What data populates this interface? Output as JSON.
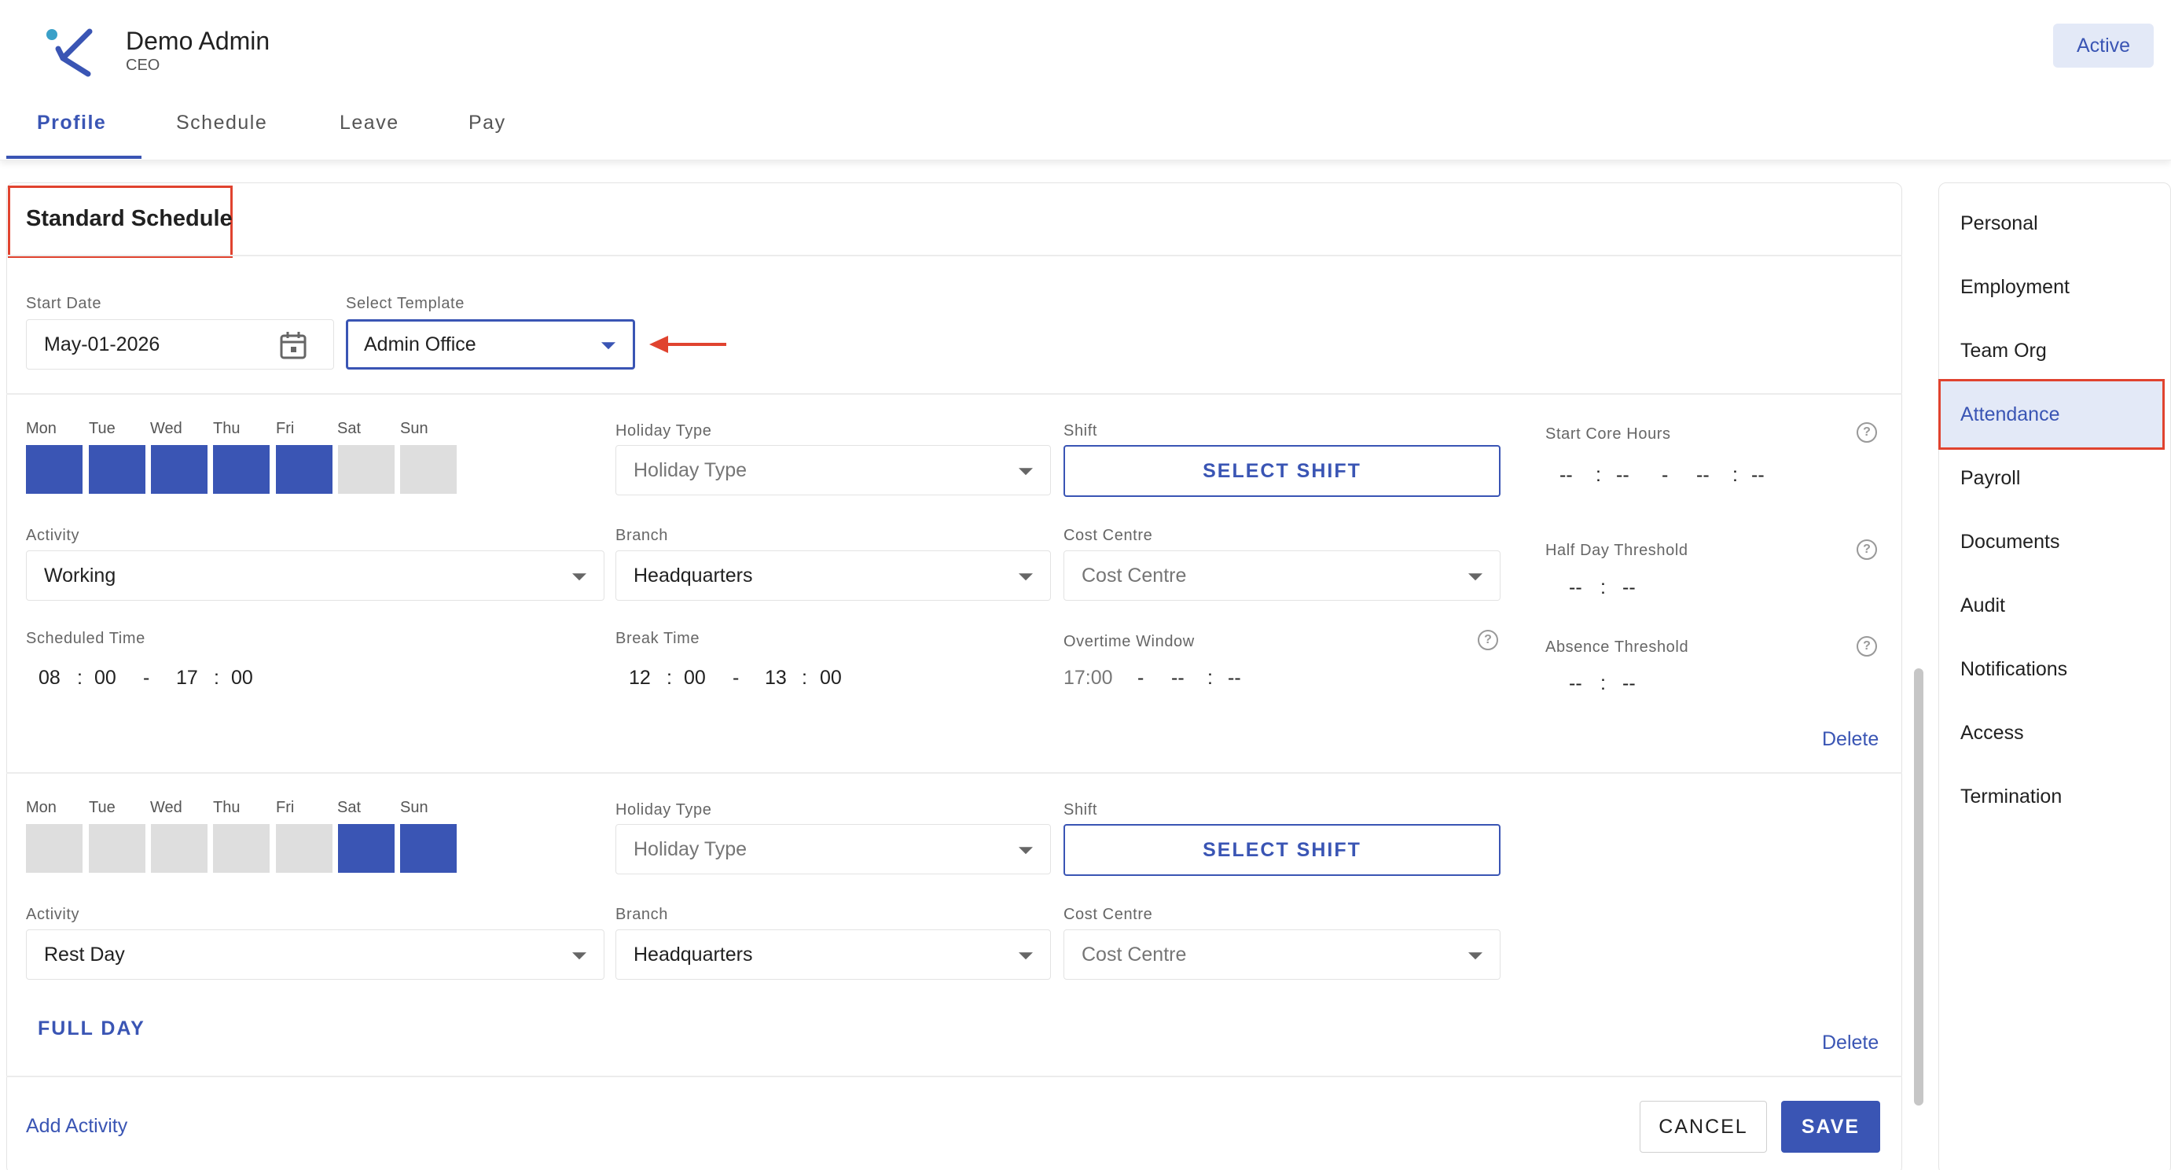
{
  "header": {
    "name": "Demo Admin",
    "role": "CEO",
    "status_badge": "Active",
    "tabs": [
      {
        "label": "Profile",
        "active": true
      },
      {
        "label": "Schedule",
        "active": false
      },
      {
        "label": "Leave",
        "active": false
      },
      {
        "label": "Pay",
        "active": false
      }
    ]
  },
  "section": {
    "title": "Standard Schedule",
    "start_date_label": "Start Date",
    "start_date_value": "May-01-2026",
    "template_label": "Select Template",
    "template_value": "Admin Office"
  },
  "days": [
    "Mon",
    "Tue",
    "Wed",
    "Thu",
    "Fri",
    "Sat",
    "Sun"
  ],
  "labels": {
    "holiday_type": "Holiday Type",
    "shift": "Shift",
    "activity": "Activity",
    "branch": "Branch",
    "cost_centre": "Cost Centre",
    "scheduled_time": "Scheduled Time",
    "break_time": "Break Time",
    "overtime_window": "Overtime Window",
    "start_core_hours": "Start Core Hours",
    "half_day_threshold": "Half Day Threshold",
    "absence_threshold": "Absence Threshold"
  },
  "rows": [
    {
      "days_selected": [
        true,
        true,
        true,
        true,
        true,
        false,
        false
      ],
      "holiday_type_placeholder": "Holiday Type",
      "shift_button": "SELECT SHIFT",
      "activity": "Working",
      "branch": "Headquarters",
      "cost_centre_placeholder": "Cost Centre",
      "scheduled_time": {
        "start_h": "08",
        "start_m": "00",
        "end_h": "17",
        "end_m": "00"
      },
      "break_time": {
        "start_h": "12",
        "start_m": "00",
        "end_h": "13",
        "end_m": "00"
      },
      "overtime_window": {
        "start": "17:00",
        "end_h": "--",
        "end_m": "--"
      },
      "start_core_hours": {
        "start_h": "--",
        "start_m": "--",
        "end_h": "--",
        "end_m": "--"
      },
      "half_day_threshold": {
        "h": "--",
        "m": "--"
      },
      "absence_threshold": {
        "h": "--",
        "m": "--"
      },
      "delete": "Delete"
    },
    {
      "days_selected": [
        false,
        false,
        false,
        false,
        false,
        true,
        true
      ],
      "holiday_type_placeholder": "Holiday Type",
      "shift_button": "SELECT SHIFT",
      "activity": "Rest Day",
      "branch": "Headquarters",
      "cost_centre_placeholder": "Cost Centre",
      "full_day": "FULL DAY",
      "delete": "Delete"
    }
  ],
  "footer": {
    "add_activity": "Add Activity",
    "cancel": "CANCEL",
    "save": "SAVE"
  },
  "sidenav": {
    "items": [
      {
        "label": "Personal"
      },
      {
        "label": "Employment"
      },
      {
        "label": "Team Org"
      },
      {
        "label": "Attendance",
        "active": true
      },
      {
        "label": "Payroll"
      },
      {
        "label": "Documents"
      },
      {
        "label": "Audit"
      },
      {
        "label": "Notifications"
      },
      {
        "label": "Access"
      },
      {
        "label": "Termination"
      }
    ]
  },
  "colors": {
    "primary": "#3a55b4",
    "annotation_red": "#e0432f",
    "inactive_day": "#dedede"
  },
  "icons": [
    "logo-icon",
    "calendar-icon",
    "chevron-down-icon",
    "help-circle-icon",
    "arrow-left-annotation"
  ]
}
